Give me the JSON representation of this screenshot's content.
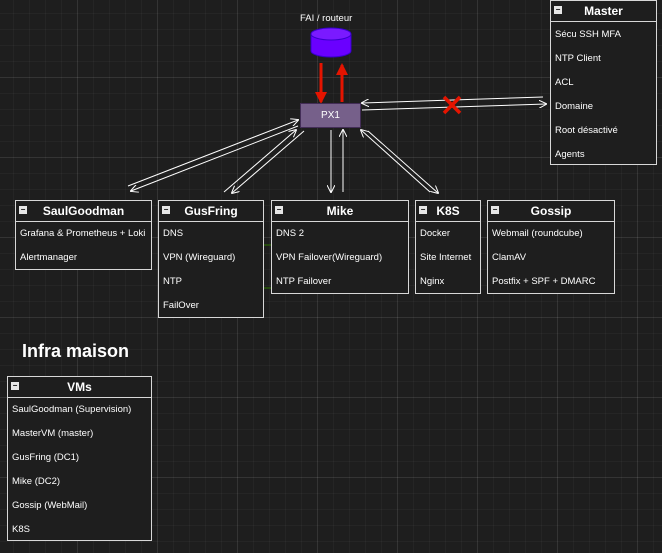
{
  "router": {
    "label": "FAI / routeur"
  },
  "proxy": {
    "label": "PX1"
  },
  "master": {
    "title": "Master",
    "items": [
      "Sécu SSH MFA",
      "NTP Client",
      "ACL",
      "Domaine",
      "Root désactivé",
      "Agents"
    ]
  },
  "saulgoodman": {
    "title": "SaulGoodman",
    "items": [
      "Grafana & Prometheus + Loki",
      "Alertmanager"
    ]
  },
  "gusfring": {
    "title": "GusFring",
    "items": [
      "DNS",
      "VPN (Wireguard)",
      "NTP",
      "FailOver"
    ]
  },
  "mike": {
    "title": "Mike",
    "items": [
      "DNS 2",
      "VPN Failover(Wireguard)",
      "NTP Failover"
    ]
  },
  "k8s": {
    "title": "K8S",
    "items": [
      "Docker",
      "Site Internet",
      "Nginx"
    ]
  },
  "gossip": {
    "title": "Gossip",
    "items": [
      "Webmail (roundcube)",
      "ClamAV",
      "Postfix + SPF + DMARC"
    ]
  },
  "section": {
    "title": "Infra maison"
  },
  "vms": {
    "title": "VMs",
    "items": [
      "SaulGoodman (Supervision)",
      "MasterVM (master)",
      "GusFring (DC1)",
      "Mike (DC2)",
      "Gossip (WebMail)",
      "K8S"
    ]
  },
  "colors": {
    "background": "#1e1e1e",
    "proxy_fill": "#76608a",
    "router_fill": "#6a00ff",
    "uplink_arrow": "#e51400",
    "sync_arrow": "#2d7600",
    "broken_link": "#e51400"
  },
  "icons": {
    "router": "database-cylinder-icon",
    "broken": "x-mark-icon",
    "collapse": "minus-square-icon"
  }
}
